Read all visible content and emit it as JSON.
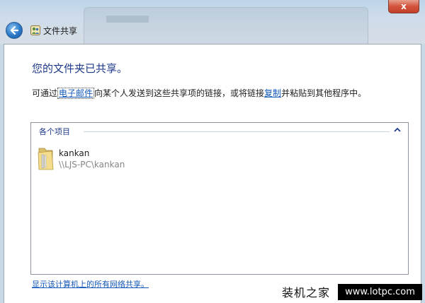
{
  "window": {
    "close_label": "x",
    "title": "文件共享"
  },
  "dialog": {
    "heading": "您的文件夹已共享。",
    "desc_prefix": "可通过",
    "email_link": "电子邮件",
    "desc_middle": "向某个人发送到这些共享项的链接，或将链接",
    "copy_link": "复制",
    "desc_suffix": "并粘贴到其他程序中。"
  },
  "list": {
    "group_label": "各个项目",
    "items": [
      {
        "name": "kankan",
        "path": "\\\\LJS-PC\\kankan"
      }
    ]
  },
  "footer": {
    "show_all_link": "显示该计算机上的所有网络共享。"
  },
  "watermark": {
    "text": "装机之家",
    "url": "www.lotpc.com"
  },
  "colors": {
    "heading": "#1e3a8a",
    "link": "#1458b8",
    "close_button": "#c2402a"
  },
  "icons": [
    "back-arrow-icon",
    "share-wizard-icon",
    "chevron-up-icon",
    "folder-icon"
  ]
}
